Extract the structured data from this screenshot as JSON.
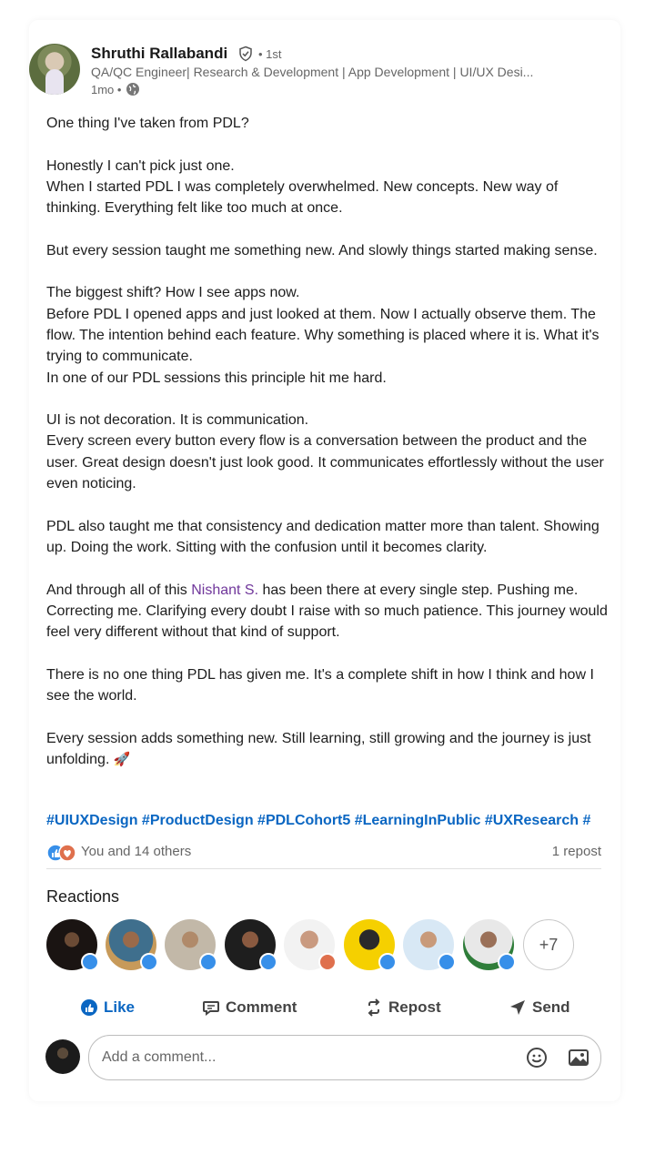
{
  "author": {
    "name": "Shruthi Rallabandi",
    "degree": "• 1st",
    "headline": "QA/QC Engineer| Research & Development | App Development | UI/UX Desi...",
    "time": "1mo •"
  },
  "post": {
    "paragraphs": [
      "One thing I've taken from PDL?",
      "Honestly I can't pick just one.\nWhen I started PDL I was completely overwhelmed. New concepts. New way of thinking. Everything felt like too much at once.",
      "But every session taught me something new. And slowly things started making sense.",
      "The biggest shift? How I see apps now.\nBefore PDL I opened apps and just looked at them. Now I actually observe them. The flow. The intention behind each feature. Why something is placed where it is. What it's trying to communicate.\nIn one of our PDL sessions this principle hit me hard.",
      "UI is not decoration. It is communication.\nEvery screen every button every flow is a conversation between the product and the user. Great design doesn't just look good. It communicates effortlessly without the user even noticing.",
      "PDL also taught me that consistency and dedication matter more than talent. Showing up. Doing the work. Sitting with the confusion until it becomes clarity."
    ],
    "para7_before": "And through all of this ",
    "mention": "Nishant S.",
    "para7_after": " has been there at every single step. Pushing me. Correcting me. Clarifying every doubt I raise with so much patience. This journey would feel very different without that kind of support.",
    "para8": "There is no one thing PDL has given me. It's a complete shift in how I think and how I see the world.",
    "para9": "Every session adds something new. Still learning, still growing and the journey is just unfolding. ",
    "rocket": "🚀",
    "hashtags": "#UIUXDesign #ProductDesign #PDLCohort5 #LearningInPublic #UXResearch #"
  },
  "social": {
    "reactions_text": "You and 14 others",
    "reposts": "1 repost"
  },
  "reactions": {
    "title": "Reactions",
    "more": "+7"
  },
  "actions": {
    "like": "Like",
    "comment": "Comment",
    "repost": "Repost",
    "send": "Send"
  },
  "comment_box": {
    "placeholder": "Add a comment..."
  },
  "colors": {
    "brand_blue": "#0a66c2",
    "mention_purple": "#70379b",
    "like_blue": "#378fe9",
    "love_orange": "#df704d"
  }
}
